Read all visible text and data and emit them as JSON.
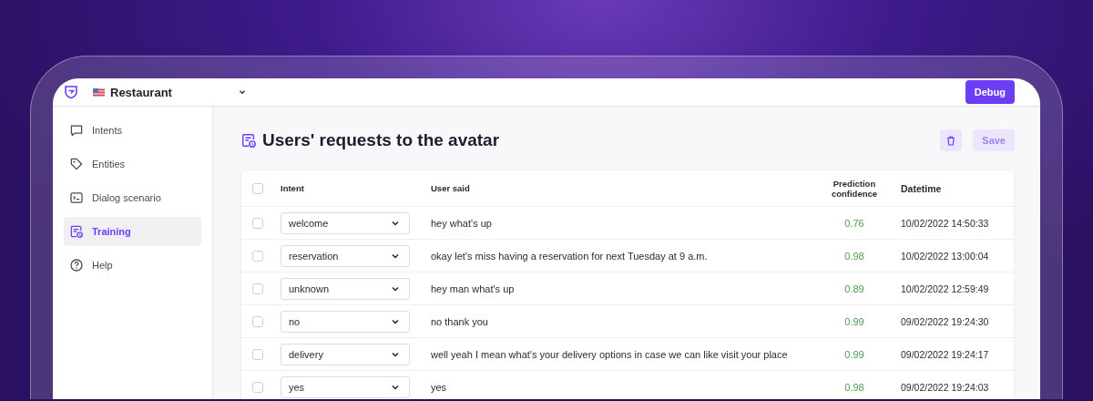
{
  "header": {
    "project": "Restaurant",
    "debug_button": "Debug"
  },
  "sidebar": {
    "items": [
      {
        "label": "Intents",
        "kind": "chat",
        "selected": false
      },
      {
        "label": "Entities",
        "kind": "tag",
        "selected": false
      },
      {
        "label": "Dialog scenario",
        "kind": "terminal",
        "selected": false
      },
      {
        "label": "Training",
        "kind": "training",
        "selected": true
      },
      {
        "label": "Help",
        "kind": "help",
        "selected": false
      }
    ]
  },
  "page": {
    "title": "Users' requests to the avatar",
    "delete_disabled": true,
    "save_button": "Save",
    "save_disabled": true
  },
  "table": {
    "columns": [
      "Intent",
      "User said",
      "Prediction confidence",
      "Datetime"
    ],
    "all_checked": false,
    "rows": [
      {
        "checked": false,
        "intent": "welcome",
        "user_said": "hey what's up",
        "confidence": "0.76",
        "datetime": "10/02/2022 14:50:33"
      },
      {
        "checked": false,
        "intent": "reservation",
        "user_said": "okay let's miss having a reservation for next Tuesday at 9 a.m.",
        "confidence": "0.98",
        "datetime": "10/02/2022 13:00:04"
      },
      {
        "checked": false,
        "intent": "unknown",
        "user_said": "hey man what's up",
        "confidence": "0.89",
        "datetime": "10/02/2022 12:59:49"
      },
      {
        "checked": false,
        "intent": "no",
        "user_said": "no thank you",
        "confidence": "0.99",
        "datetime": "09/02/2022 19:24:30"
      },
      {
        "checked": false,
        "intent": "delivery",
        "user_said": "well yeah I mean what's your delivery options in case we can like visit your place",
        "confidence": "0.99",
        "datetime": "09/02/2022 19:24:17"
      },
      {
        "checked": false,
        "intent": "yes",
        "user_said": "yes",
        "confidence": "0.98",
        "datetime": "09/02/2022 19:24:03"
      }
    ]
  }
}
